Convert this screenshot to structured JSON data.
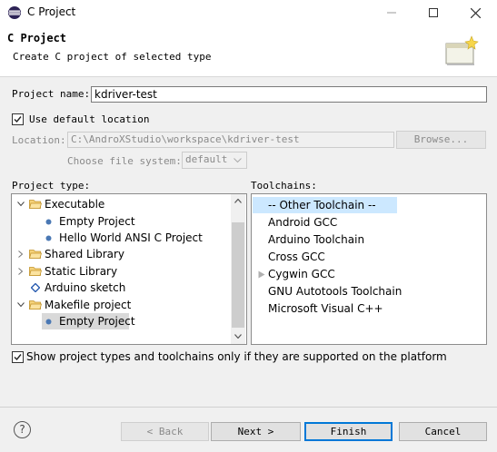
{
  "window": {
    "title": "C Project"
  },
  "header": {
    "title": "C Project",
    "description": "Create C project of selected type"
  },
  "project_name": {
    "label": "Project name:",
    "value": "kdriver-test"
  },
  "default_location": {
    "label": "Use default location",
    "checked": true
  },
  "location": {
    "label": "Location:",
    "value": "C:\\AndroXStudio\\workspace\\kdriver-test",
    "browse_label": "Browse..."
  },
  "file_system": {
    "label": "Choose file system:",
    "value": "default"
  },
  "project_type": {
    "label": "Project type:",
    "items": [
      {
        "label": "Executable",
        "expander": "open",
        "icon": "folder-open-icon",
        "level": 0
      },
      {
        "label": "Empty Project",
        "icon": "bullet-icon",
        "level": 1
      },
      {
        "label": "Hello World ANSI C Project",
        "icon": "bullet-icon",
        "level": 1
      },
      {
        "label": "Shared Library",
        "expander": "closed",
        "icon": "folder-open-icon",
        "level": 0
      },
      {
        "label": "Static Library",
        "expander": "closed",
        "icon": "folder-open-icon",
        "level": 0
      },
      {
        "label": "Arduino sketch",
        "icon": "diamond-icon",
        "level": 0
      },
      {
        "label": "Makefile project",
        "expander": "open",
        "icon": "folder-open-icon",
        "level": 0
      },
      {
        "label": "Empty Project",
        "icon": "bullet-icon",
        "level": 1,
        "selected": true
      }
    ]
  },
  "toolchains": {
    "label": "Toolchains:",
    "items": [
      {
        "label": "-- Other Toolchain --",
        "selected": true
      },
      {
        "label": "Android GCC"
      },
      {
        "label": "Arduino Toolchain"
      },
      {
        "label": "Cross GCC"
      },
      {
        "label": "Cygwin GCC",
        "marker": true
      },
      {
        "label": "GNU Autotools Toolchain"
      },
      {
        "label": "Microsoft Visual C++"
      }
    ]
  },
  "filter_checkbox": {
    "label": "Show project types and toolchains only if they are supported on the platform",
    "checked": true
  },
  "buttons": {
    "back": "< Back",
    "next": "Next >",
    "finish": "Finish",
    "cancel": "Cancel",
    "help": "?"
  },
  "colors": {
    "selection": "#cce8ff",
    "default_button_border": "#0078d7",
    "bullet": "#4a78b4",
    "folder": "#e8b84a"
  }
}
